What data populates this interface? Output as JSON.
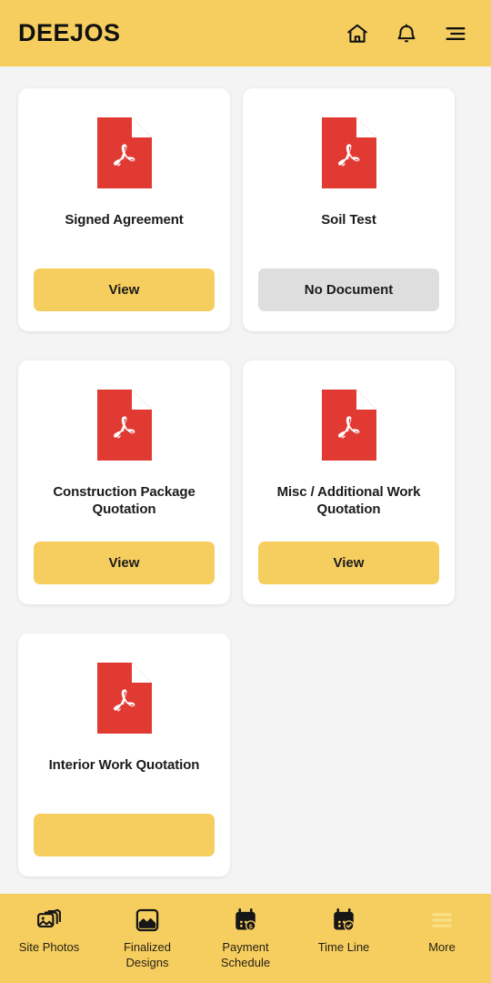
{
  "header": {
    "brand": "DEEJOS",
    "icons": [
      {
        "name": "home-icon"
      },
      {
        "name": "notification-bell-icon"
      },
      {
        "name": "hamburger-menu-icon"
      }
    ]
  },
  "colors": {
    "brand_yellow": "#f6ce5f",
    "page_background": "#f4f4f5",
    "card_background": "#ffffff",
    "pdf_red": "#e03a33",
    "disabled_grey": "#dedede",
    "text_dark": "#1b1b1b",
    "nav_active_icon": "#f9e089"
  },
  "documents": [
    {
      "title": "Signed Agreement",
      "icon": "pdf-file-icon",
      "button_label": "View",
      "available": true
    },
    {
      "title": "Soil Test",
      "icon": "pdf-file-icon",
      "button_label": "No Document",
      "available": false
    },
    {
      "title": "Construction Package Quotation",
      "icon": "pdf-file-icon",
      "button_label": "View",
      "available": true
    },
    {
      "title": "Misc / Additional Work Quotation",
      "icon": "pdf-file-icon",
      "button_label": "View",
      "available": true
    },
    {
      "title": "Interior Work Quotation",
      "icon": "pdf-file-icon",
      "button_label": "",
      "available": true
    }
  ],
  "bottom_nav": {
    "items": [
      {
        "label": "Site Photos",
        "icon": "photos-stack-icon",
        "active": false
      },
      {
        "label": "Finalized Designs",
        "icon": "image-filled-icon",
        "active": false
      },
      {
        "label": "Payment Schedule",
        "icon": "calendar-dollar-icon",
        "active": false
      },
      {
        "label": "Time Line",
        "icon": "calendar-check-icon",
        "active": false
      },
      {
        "label": "More",
        "icon": "hamburger-menu-icon",
        "active": true
      }
    ]
  }
}
